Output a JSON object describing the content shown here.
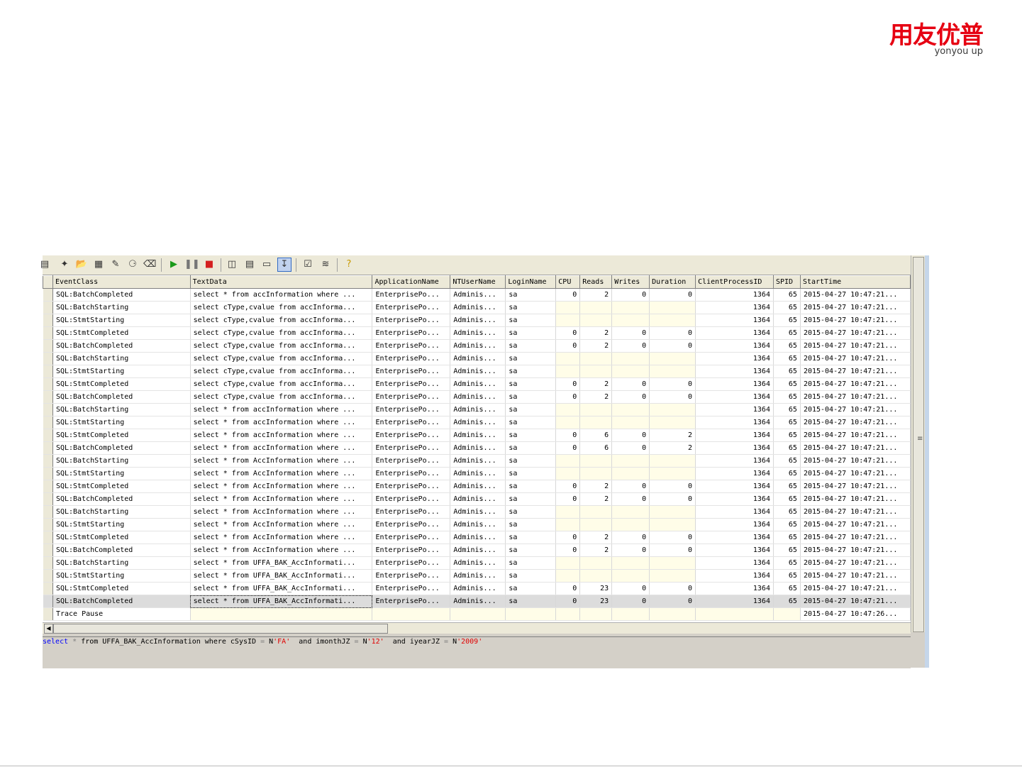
{
  "logo": {
    "chinese": "用友优普",
    "english": "yonyou up"
  },
  "colors": {
    "brand_red": "#e60012",
    "empty_cell": "#fffde8",
    "selected_row": "#dcdcdc",
    "sql_keyword": "#0000ff",
    "sql_string": "#e00000"
  },
  "toolbar": {
    "icons": [
      "properties-icon",
      "new-trace-icon",
      "open-icon",
      "save-icon",
      "template-icon",
      "find-icon",
      "clear-icon",
      "run-icon",
      "pause-icon",
      "stop-icon",
      "sql-icon",
      "extract-icon",
      "aggregate-icon",
      "autoscroll-icon",
      "options-icon",
      "perfmon-icon",
      "help-icon"
    ]
  },
  "trace": {
    "columns": [
      "EventClass",
      "TextData",
      "ApplicationName",
      "NTUserName",
      "LoginName",
      "CPU",
      "Reads",
      "Writes",
      "Duration",
      "ClientProcessID",
      "SPID",
      "StartTime"
    ],
    "rows": [
      [
        "SQL:BatchCompleted",
        "select * from accInformation where ...",
        "EnterprisePo...",
        "Adminis...",
        "sa",
        "0",
        "2",
        "0",
        "0",
        "1364",
        "65",
        "2015-04-27 10:47:21..."
      ],
      [
        "SQL:BatchStarting",
        "select cType,cvalue from accInforma...",
        "EnterprisePo...",
        "Adminis...",
        "sa",
        "",
        "",
        "",
        "",
        "1364",
        "65",
        "2015-04-27 10:47:21..."
      ],
      [
        "SQL:StmtStarting",
        "select cType,cvalue from accInforma...",
        "EnterprisePo...",
        "Adminis...",
        "sa",
        "",
        "",
        "",
        "",
        "1364",
        "65",
        "2015-04-27 10:47:21..."
      ],
      [
        "SQL:StmtCompleted",
        "select cType,cvalue from accInforma...",
        "EnterprisePo...",
        "Adminis...",
        "sa",
        "0",
        "2",
        "0",
        "0",
        "1364",
        "65",
        "2015-04-27 10:47:21..."
      ],
      [
        "SQL:BatchCompleted",
        "select cType,cvalue from accInforma...",
        "EnterprisePo...",
        "Adminis...",
        "sa",
        "0",
        "2",
        "0",
        "0",
        "1364",
        "65",
        "2015-04-27 10:47:21..."
      ],
      [
        "SQL:BatchStarting",
        "select cType,cvalue from accInforma...",
        "EnterprisePo...",
        "Adminis...",
        "sa",
        "",
        "",
        "",
        "",
        "1364",
        "65",
        "2015-04-27 10:47:21..."
      ],
      [
        "SQL:StmtStarting",
        "select cType,cvalue from accInforma...",
        "EnterprisePo...",
        "Adminis...",
        "sa",
        "",
        "",
        "",
        "",
        "1364",
        "65",
        "2015-04-27 10:47:21..."
      ],
      [
        "SQL:StmtCompleted",
        "select cType,cvalue from accInforma...",
        "EnterprisePo...",
        "Adminis...",
        "sa",
        "0",
        "2",
        "0",
        "0",
        "1364",
        "65",
        "2015-04-27 10:47:21..."
      ],
      [
        "SQL:BatchCompleted",
        "select cType,cvalue from accInforma...",
        "EnterprisePo...",
        "Adminis...",
        "sa",
        "0",
        "2",
        "0",
        "0",
        "1364",
        "65",
        "2015-04-27 10:47:21..."
      ],
      [
        "SQL:BatchStarting",
        "select * from accInformation where ...",
        "EnterprisePo...",
        "Adminis...",
        "sa",
        "",
        "",
        "",
        "",
        "1364",
        "65",
        "2015-04-27 10:47:21..."
      ],
      [
        "SQL:StmtStarting",
        "select * from accInformation where ...",
        "EnterprisePo...",
        "Adminis...",
        "sa",
        "",
        "",
        "",
        "",
        "1364",
        "65",
        "2015-04-27 10:47:21..."
      ],
      [
        "SQL:StmtCompleted",
        "select * from accInformation where ...",
        "EnterprisePo...",
        "Adminis...",
        "sa",
        "0",
        "6",
        "0",
        "2",
        "1364",
        "65",
        "2015-04-27 10:47:21..."
      ],
      [
        "SQL:BatchCompleted",
        "select * from accInformation where ...",
        "EnterprisePo...",
        "Adminis...",
        "sa",
        "0",
        "6",
        "0",
        "2",
        "1364",
        "65",
        "2015-04-27 10:47:21..."
      ],
      [
        "SQL:BatchStarting",
        "select * from AccInformation where ...",
        "EnterprisePo...",
        "Adminis...",
        "sa",
        "",
        "",
        "",
        "",
        "1364",
        "65",
        "2015-04-27 10:47:21..."
      ],
      [
        "SQL:StmtStarting",
        "select * from AccInformation where ...",
        "EnterprisePo...",
        "Adminis...",
        "sa",
        "",
        "",
        "",
        "",
        "1364",
        "65",
        "2015-04-27 10:47:21..."
      ],
      [
        "SQL:StmtCompleted",
        "select * from AccInformation where ...",
        "EnterprisePo...",
        "Adminis...",
        "sa",
        "0",
        "2",
        "0",
        "0",
        "1364",
        "65",
        "2015-04-27 10:47:21..."
      ],
      [
        "SQL:BatchCompleted",
        "select * from AccInformation where ...",
        "EnterprisePo...",
        "Adminis...",
        "sa",
        "0",
        "2",
        "0",
        "0",
        "1364",
        "65",
        "2015-04-27 10:47:21..."
      ],
      [
        "SQL:BatchStarting",
        "select * from AccInformation where ...",
        "EnterprisePo...",
        "Adminis...",
        "sa",
        "",
        "",
        "",
        "",
        "1364",
        "65",
        "2015-04-27 10:47:21..."
      ],
      [
        "SQL:StmtStarting",
        "select * from AccInformation where ...",
        "EnterprisePo...",
        "Adminis...",
        "sa",
        "",
        "",
        "",
        "",
        "1364",
        "65",
        "2015-04-27 10:47:21..."
      ],
      [
        "SQL:StmtCompleted",
        "select * from AccInformation where ...",
        "EnterprisePo...",
        "Adminis...",
        "sa",
        "0",
        "2",
        "0",
        "0",
        "1364",
        "65",
        "2015-04-27 10:47:21..."
      ],
      [
        "SQL:BatchCompleted",
        "select * from AccInformation where ...",
        "EnterprisePo...",
        "Adminis...",
        "sa",
        "0",
        "2",
        "0",
        "0",
        "1364",
        "65",
        "2015-04-27 10:47:21..."
      ],
      [
        "SQL:BatchStarting",
        "select * from UFFA_BAK_AccInformati...",
        "EnterprisePo...",
        "Adminis...",
        "sa",
        "",
        "",
        "",
        "",
        "1364",
        "65",
        "2015-04-27 10:47:21..."
      ],
      [
        "SQL:StmtStarting",
        "select * from UFFA_BAK_AccInformati...",
        "EnterprisePo...",
        "Adminis...",
        "sa",
        "",
        "",
        "",
        "",
        "1364",
        "65",
        "2015-04-27 10:47:21..."
      ],
      [
        "SQL:StmtCompleted",
        "select * from UFFA_BAK_AccInformati...",
        "EnterprisePo...",
        "Adminis...",
        "sa",
        "0",
        "23",
        "0",
        "0",
        "1364",
        "65",
        "2015-04-27 10:47:21..."
      ],
      [
        "SQL:BatchCompleted",
        "select * from UFFA_BAK_AccInformati...",
        "EnterprisePo...",
        "Adminis...",
        "sa",
        "0",
        "23",
        "0",
        "0",
        "1364",
        "65",
        "2015-04-27 10:47:21..."
      ],
      [
        "Trace Pause",
        "",
        "",
        "",
        "",
        "",
        "",
        "",
        "",
        "",
        "",
        "2015-04-27 10:47:26..."
      ]
    ],
    "selected_row_index": 24
  },
  "sql_pane": {
    "parts": [
      {
        "text": "select",
        "cls": "kw"
      },
      {
        "text": " * ",
        "cls": "op"
      },
      {
        "text": "from UFFA_BAK_AccInformation where cSysID ",
        "cls": ""
      },
      {
        "text": "=",
        "cls": "op"
      },
      {
        "text": " N",
        "cls": ""
      },
      {
        "text": "'FA'",
        "cls": "str"
      },
      {
        "text": "  and imonthJZ ",
        "cls": ""
      },
      {
        "text": "=",
        "cls": "op"
      },
      {
        "text": " N",
        "cls": ""
      },
      {
        "text": "'12'",
        "cls": "str"
      },
      {
        "text": "  and iyearJZ ",
        "cls": ""
      },
      {
        "text": "=",
        "cls": "op"
      },
      {
        "text": " N",
        "cls": ""
      },
      {
        "text": "'2009'",
        "cls": "str"
      }
    ]
  }
}
